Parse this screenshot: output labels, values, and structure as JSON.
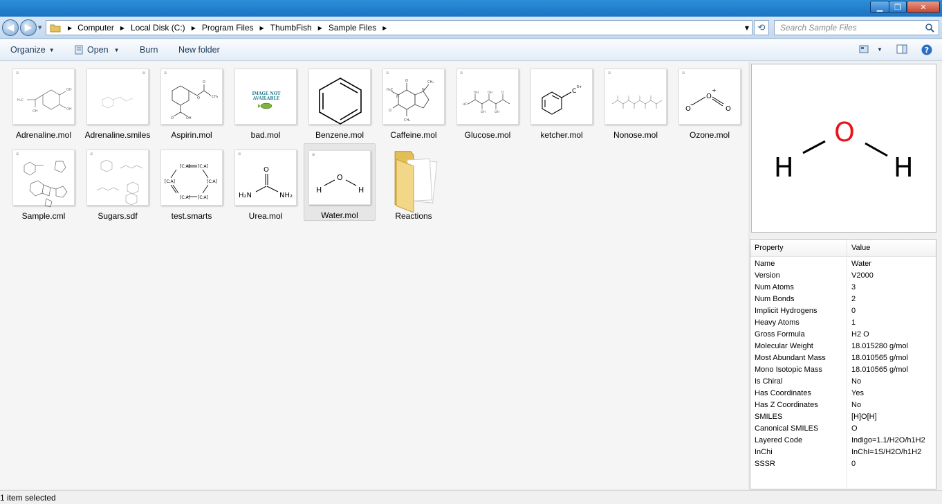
{
  "window": {
    "minimize_glyph": "▁",
    "maximize_glyph": "❐",
    "close_glyph": "✕"
  },
  "address": {
    "breadcrumbs": [
      "Computer",
      "Local Disk (C:)",
      "Program Files",
      "ThumbFish",
      "Sample Files"
    ],
    "search_placeholder": "Search Sample Files"
  },
  "toolbar": {
    "organize": "Organize",
    "open": "Open",
    "burn": "Burn",
    "new_folder": "New folder"
  },
  "files": [
    {
      "name": "Adrenaline.mol",
      "icon": "molecule-thumbnail"
    },
    {
      "name": "Adrenaline.smiles",
      "icon": "molecule-thumbnail"
    },
    {
      "name": "Aspirin.mol",
      "icon": "molecule-thumbnail"
    },
    {
      "name": "bad.mol",
      "icon": "image-not-available-thumbnail",
      "text1": "IMAGE NOT",
      "text2": "AVAILABLE"
    },
    {
      "name": "Benzene.mol",
      "icon": "molecule-thumbnail"
    },
    {
      "name": "Caffeine.mol",
      "icon": "molecule-thumbnail"
    },
    {
      "name": "Glucose.mol",
      "icon": "molecule-thumbnail"
    },
    {
      "name": "ketcher.mol",
      "icon": "molecule-thumbnail",
      "atom": "C",
      "charge": "5+"
    },
    {
      "name": "Nonose.mol",
      "icon": "molecule-thumbnail"
    },
    {
      "name": "Ozone.mol",
      "icon": "molecule-thumbnail",
      "atoms": [
        "O",
        "O",
        "O"
      ],
      "charges": [
        "-",
        "+"
      ]
    },
    {
      "name": "Sample.cml",
      "icon": "molecule-thumbnail"
    },
    {
      "name": "Sugars.sdf",
      "icon": "molecule-thumbnail"
    },
    {
      "name": "test.smarts",
      "icon": "molecule-thumbnail",
      "atoms": [
        "[C;A]",
        "[C;A]",
        "[C;A]",
        "[C;A]",
        "[C;A]",
        "[C;A]"
      ]
    },
    {
      "name": "Urea.mol",
      "icon": "molecule-thumbnail",
      "atoms": [
        "O",
        "H₂N",
        "NH₂"
      ]
    },
    {
      "name": "Water.mol",
      "icon": "molecule-thumbnail",
      "atoms": [
        "H",
        "O",
        "H"
      ],
      "selected": true
    },
    {
      "name": "Reactions",
      "icon": "folder-icon"
    }
  ],
  "preview": {
    "atoms": [
      "H",
      "O",
      "H"
    ],
    "oxygen_color": "#e8141c"
  },
  "properties": {
    "header": [
      "Property",
      "Value"
    ],
    "rows": [
      [
        "Name",
        "Water"
      ],
      [
        "Version",
        "V2000"
      ],
      [
        "Num Atoms",
        "3"
      ],
      [
        "Num Bonds",
        "2"
      ],
      [
        "Implicit Hydrogens",
        "0"
      ],
      [
        "Heavy Atoms",
        "1"
      ],
      [
        "Gross Formula",
        "H2 O"
      ],
      [
        "Molecular Weight",
        "18.015280 g/mol"
      ],
      [
        "Most Abundant Mass",
        "18.010565 g/mol"
      ],
      [
        "Mono Isotopic Mass",
        "18.010565 g/mol"
      ],
      [
        "Is Chiral",
        "No"
      ],
      [
        "Has Coordinates",
        "Yes"
      ],
      [
        "Has Z Coordinates",
        "No"
      ],
      [
        "SMILES",
        "[H]O[H]"
      ],
      [
        "Canonical SMILES",
        "O"
      ],
      [
        "Layered Code",
        "Indigo=1.1/H2O/h1H2"
      ],
      [
        "InChi",
        "InChI=1S/H2O/h1H2"
      ],
      [
        "SSSR",
        "0"
      ]
    ]
  },
  "status": {
    "text": "1 item selected"
  }
}
